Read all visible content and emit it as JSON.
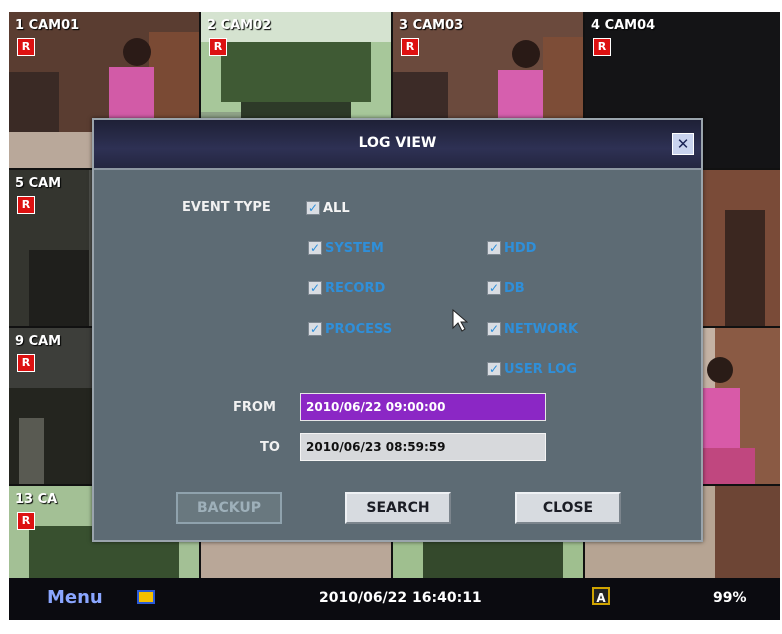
{
  "colors": {
    "dialog_bg": "#5d6b74",
    "title_bar": "#2e3154",
    "checkbox_text": "#2f8fd9",
    "from_field_bg": "#8b27c5",
    "to_field_bg": "#d7d9dc",
    "record_badge": "#dd1111"
  },
  "cameras": [
    {
      "label": "1 CAM01",
      "rec": "R"
    },
    {
      "label": "2 CAM02",
      "rec": "R"
    },
    {
      "label": "3 CAM03",
      "rec": "R"
    },
    {
      "label": "4 CAM04",
      "rec": "R"
    },
    {
      "label": "5 CAM",
      "rec": "R"
    },
    {
      "label": "9 CAM",
      "rec": "R"
    },
    {
      "label": "13 CA",
      "rec": "R"
    }
  ],
  "dialog": {
    "title": "LOG VIEW",
    "close_icon": "close-x-icon",
    "event_type_label": "EVENT TYPE",
    "all_label": "ALL",
    "options": {
      "system": "SYSTEM",
      "record": "RECORD",
      "process": "PROCESS",
      "hdd": "HDD",
      "db": "DB",
      "network": "NETWORK",
      "user_log": "USER LOG"
    },
    "from_label": "FROM",
    "from_value": "2010/06/22 09:00:00",
    "to_label": "TO",
    "to_value": "2010/06/23 08:59:59",
    "buttons": {
      "backup": "BACKUP",
      "search": "SEARCH",
      "close": "CLOSE"
    }
  },
  "statusbar": {
    "menu": "Menu",
    "datetime": "2010/06/22 16:40:11",
    "a_badge": "A",
    "percent": "99%"
  }
}
